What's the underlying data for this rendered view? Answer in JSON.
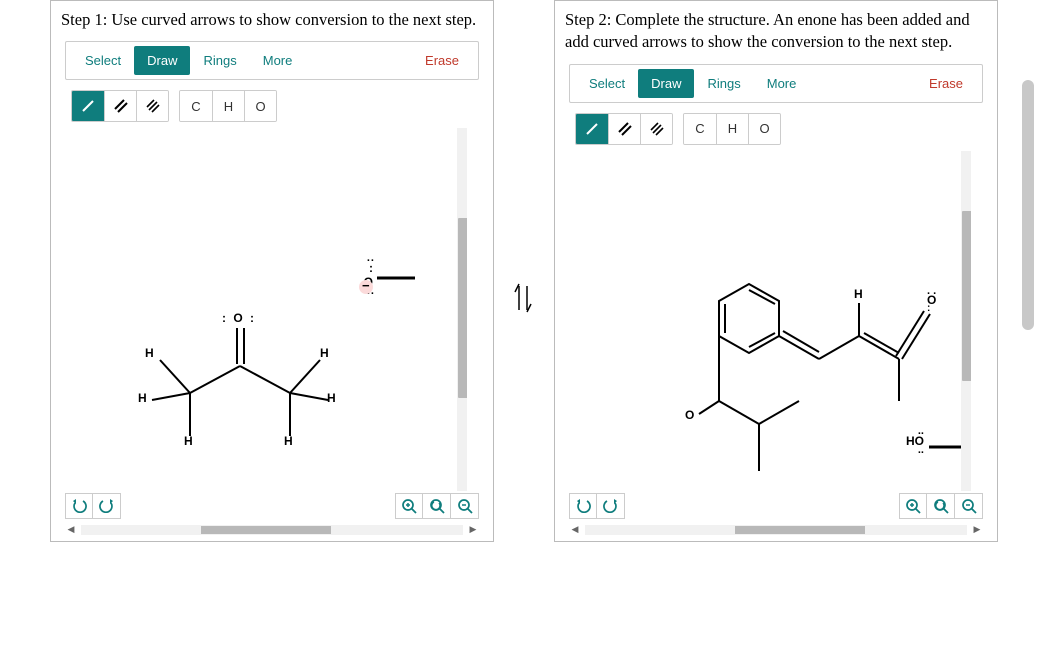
{
  "step1": {
    "prompt": "Step 1: Use curved arrows to show conversion to the next step.",
    "tabs": {
      "select": "Select",
      "draw": "Draw",
      "rings": "Rings",
      "more": "More",
      "erase": "Erase"
    },
    "atoms": {
      "c": "C",
      "h": "H",
      "o": "O"
    },
    "labels": {
      "h1": "H",
      "h2": "H",
      "h3": "H",
      "h4": "H",
      "h5": "H",
      "h6": "H",
      "o_lp": ": O :",
      "o_base": ": O",
      "neg": "−"
    }
  },
  "step2": {
    "prompt": "Step 2: Complete the structure. An enone has been added and add curved arrows to show the conversion to the next step.",
    "tabs": {
      "select": "Select",
      "draw": "Draw",
      "rings": "Rings",
      "more": "More",
      "erase": "Erase"
    },
    "atoms": {
      "c": "C",
      "h": "H",
      "o": "O"
    },
    "labels": {
      "h1": "H",
      "o_db": "O",
      "o_single": "O",
      "ho": "HO"
    }
  }
}
